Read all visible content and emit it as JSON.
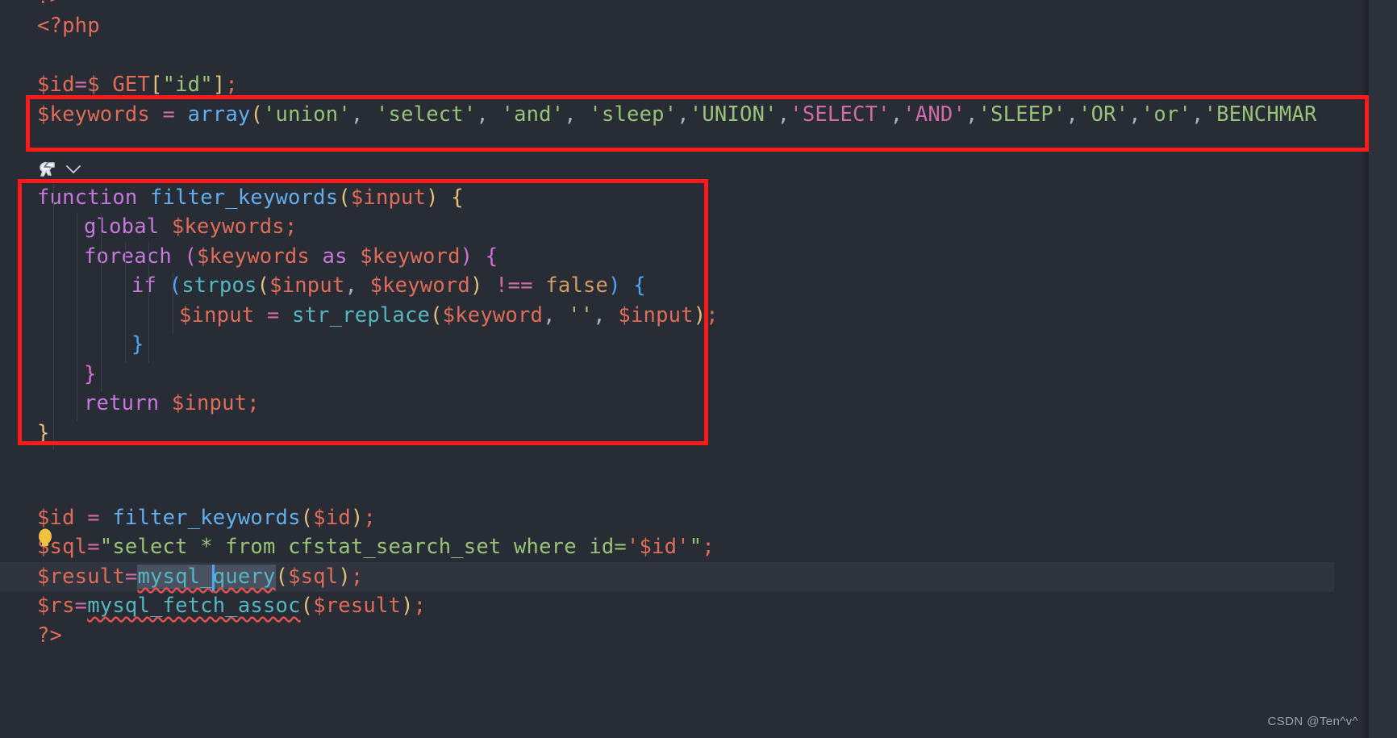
{
  "editor": {
    "language": "php",
    "theme": "one-dark-pro",
    "background": "#282c34",
    "annotation_color": "#ff1a1a",
    "selection_color": "#4a5160",
    "caret_color": "#4fa6ff",
    "squiggle_color": "#e05252"
  },
  "lines": {
    "l1_close_tag": "?>",
    "l2_open_tag": "<?php",
    "l4_id": {
      "var": "$id",
      "eq": "=",
      "super": "$_GET",
      "lb": "[",
      "str": "\"id\"",
      "rb": "]",
      "semi": ";"
    },
    "l5_keywords": {
      "var": "$keywords",
      "eq": "=",
      "fn": "array",
      "lp": "(",
      "items": [
        "'union'",
        "'select'",
        "'and'",
        "'sleep'",
        "'UNION'",
        "'SELECT'",
        "'AND'",
        "'SLEEP'",
        "'OR'",
        "'or'",
        "'BENCHMAR"
      ],
      "full_text": "$keywords = array('union', 'select', 'and', 'sleep','UNION','SELECT','AND','SLEEP','OR','or','BENCHMAR"
    },
    "l7_function_sig": {
      "kw": "function",
      "name": "filter_keywords",
      "lp": "(",
      "param": "$input",
      "rp": ")",
      "brace": "{"
    },
    "l8_global": {
      "kw": "global",
      "var": "$keywords",
      "semi": ";"
    },
    "l9_foreach": {
      "kw": "foreach",
      "lp": "(",
      "arr": "$keywords",
      "as": "as",
      "item": "$keyword",
      "rp": ")",
      "brace": "{"
    },
    "l10_if": {
      "kw": "if",
      "lp": "(",
      "fn": "strpos",
      "lp2": "(",
      "a1": "$input",
      "comma": ",",
      "a2": "$keyword",
      "rp2": ")",
      "op": "!==",
      "const": "false",
      "rp": ")",
      "brace": "{"
    },
    "l11_replace": {
      "var": "$input",
      "eq": "=",
      "fn": "str_replace",
      "lp": "(",
      "a1": "$keyword",
      "c1": ",",
      "a2": "''",
      "c2": ",",
      "a3": "$input",
      "rp": ")",
      "semi": ";"
    },
    "l12_close_if": "}",
    "l13_close_foreach": "}",
    "l14_return": {
      "kw": "return",
      "var": "$input",
      "semi": ";"
    },
    "l15_close_fn": "}",
    "l18_filter_call": {
      "var": "$id",
      "eq": "=",
      "fn": "filter_keywords",
      "lp": "(",
      "arg": "$id",
      "rp": ")",
      "semi": ";"
    },
    "l19_sql": {
      "var": "$sql",
      "eq": "=",
      "str": "\"select * from cfstat_search_set where id='$id'\"",
      "semi": ";",
      "str_open": "\"select * from cfstat_search_set where id=",
      "str_var": "'$id'",
      "str_close": "\""
    },
    "l20_result": {
      "var": "$result",
      "eq": "=",
      "fn_left": "mysql_",
      "fn_right": "query",
      "fn_full": "mysql_query",
      "lp": "(",
      "arg": "$sql",
      "rp": ")",
      "semi": ";"
    },
    "l21_fetch": {
      "var": "$rs",
      "eq": "=",
      "fn": "mysql_fetch_assoc",
      "lp": "(",
      "arg": "$result",
      "rp": ")",
      "semi": ";"
    },
    "l22_close_tag": "?>"
  },
  "codelens": {
    "icon": "php-elephant-icon",
    "chevron": "chevron-down-icon"
  },
  "quickfix": {
    "icon": "lightbulb-icon",
    "color": "#f0c040"
  },
  "annotations": [
    {
      "name": "keywords-array-highlight-box"
    },
    {
      "name": "filter-function-highlight-box"
    }
  ],
  "watermark": {
    "text": "CSDN @Ten^v^"
  }
}
